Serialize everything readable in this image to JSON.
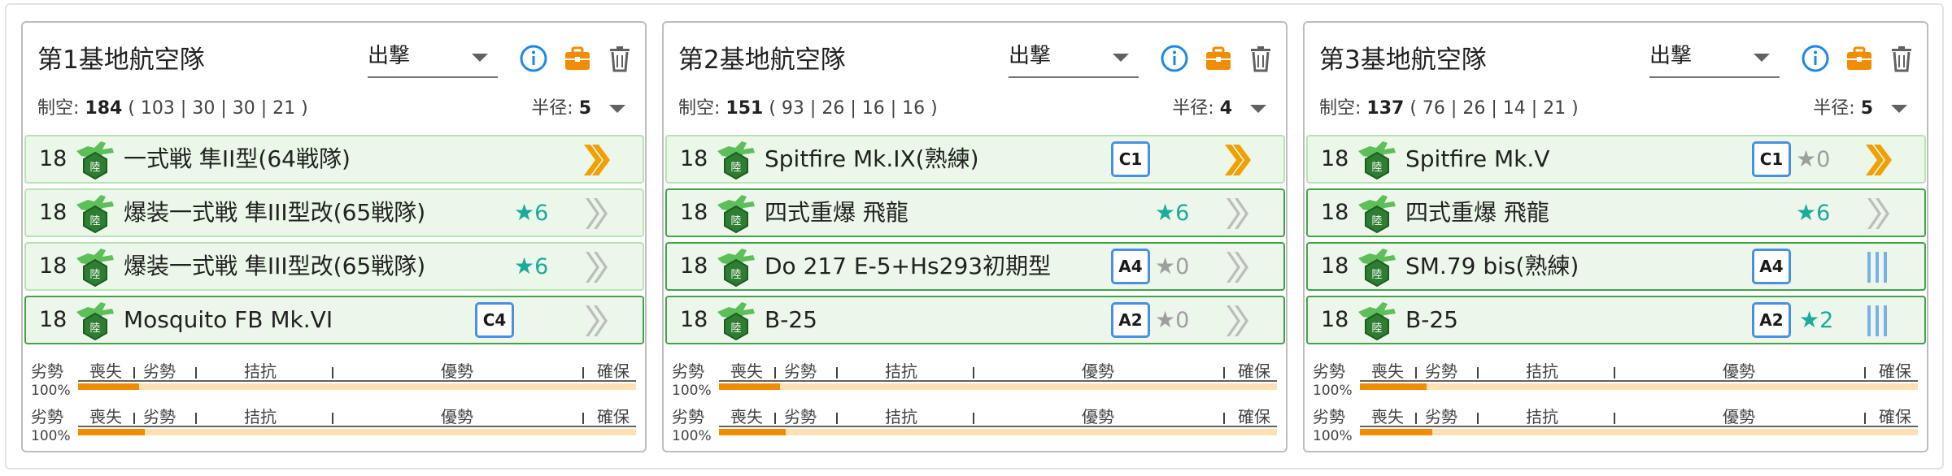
{
  "cards": [
    {
      "title": "第1基地航空隊",
      "mode": "出撃",
      "stats": {
        "label": "制空:",
        "total": "184",
        "breakdown": "( 103 | 30 | 30 | 21 )"
      },
      "radius": {
        "label": "半径:",
        "value": "5"
      },
      "rows": [
        {
          "count": "18",
          "name": "一式戦 隼II型(64戦隊)",
          "badge": "",
          "proficiency": "",
          "rank": "gold"
        },
        {
          "count": "18",
          "name": "爆装一式戦 隼III型改(65戦隊)",
          "badge": "",
          "proficiency": "6",
          "rank": "grey"
        },
        {
          "count": "18",
          "name": "爆装一式戦 隼III型改(65戦隊)",
          "badge": "",
          "proficiency": "6",
          "rank": "grey"
        },
        {
          "count": "18",
          "name": "Mosquito FB Mk.VI",
          "badge": "C4",
          "proficiency": "",
          "rank": "grey"
        }
      ],
      "bars": [
        {
          "fill_percent": 11
        },
        {
          "fill_percent": 12
        }
      ]
    },
    {
      "title": "第2基地航空隊",
      "mode": "出撃",
      "stats": {
        "label": "制空:",
        "total": "151",
        "breakdown": "( 93 | 26 | 16 | 16 )"
      },
      "radius": {
        "label": "半径:",
        "value": "4"
      },
      "rows": [
        {
          "count": "18",
          "name": "Spitfire Mk.IX(熟練)",
          "badge": "C1",
          "proficiency": "",
          "rank": "gold"
        },
        {
          "count": "18",
          "name": "四式重爆 飛龍",
          "badge": "",
          "proficiency": "6",
          "rank": "grey"
        },
        {
          "count": "18",
          "name": "Do 217 E-5+Hs293初期型",
          "badge": "A4",
          "proficiency": "0",
          "rank": "grey"
        },
        {
          "count": "18",
          "name": "B-25",
          "badge": "A2",
          "proficiency": "0",
          "rank": "grey"
        }
      ],
      "bars": [
        {
          "fill_percent": 11
        },
        {
          "fill_percent": 12
        }
      ]
    },
    {
      "title": "第3基地航空隊",
      "mode": "出撃",
      "stats": {
        "label": "制空:",
        "total": "137",
        "breakdown": "( 76 | 26 | 14 | 21 )"
      },
      "radius": {
        "label": "半径:",
        "value": "5"
      },
      "rows": [
        {
          "count": "18",
          "name": "Spitfire Mk.V",
          "badge": "C1",
          "proficiency": "0",
          "rank": "gold"
        },
        {
          "count": "18",
          "name": "四式重爆 飛龍",
          "badge": "",
          "proficiency": "6",
          "rank": "grey"
        },
        {
          "count": "18",
          "name": "SM.79 bis(熟練)",
          "badge": "A4",
          "proficiency": "",
          "rank": "blue"
        },
        {
          "count": "18",
          "name": "B-25",
          "badge": "A2",
          "proficiency": "2",
          "rank": "blue"
        }
      ],
      "bars": [
        {
          "fill_percent": 12
        },
        {
          "fill_percent": 13
        }
      ]
    }
  ],
  "air_state_labels": {
    "prefix": "劣勢",
    "loss": "喪失",
    "inferior": "劣勢",
    "parity": "拮抗",
    "superior": "優勢",
    "supremacy": "確保",
    "percent": "100%"
  },
  "colors": {
    "star_active": "#1aab9b",
    "star_zero": "#9e9e9e",
    "rank_gold": "#f0a000",
    "rank_grey": "#bdbdbd",
    "rank_blue": "#7ab0e8",
    "badge_border": "#4a90e2",
    "bar_fill": "#f08c00",
    "bar_track": "#ffe0b2",
    "info_icon": "#1e88e5",
    "case_icon": "#f08c00",
    "trash_icon": "#616161"
  }
}
